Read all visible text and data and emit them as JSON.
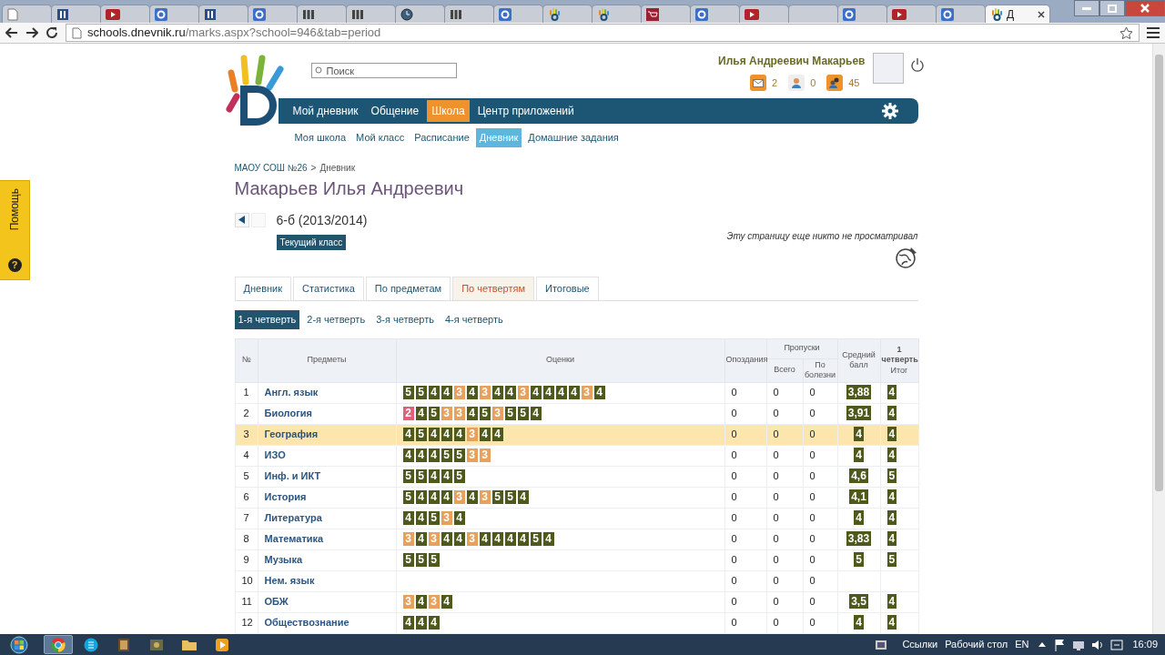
{
  "browser": {
    "tabs": [
      {
        "kind": "page",
        "selected": false
      },
      {
        "kind": "doc",
        "selected": false
      },
      {
        "kind": "video",
        "selected": false
      },
      {
        "kind": "tile",
        "selected": false
      },
      {
        "kind": "doc",
        "selected": false
      },
      {
        "kind": "tile",
        "selected": false
      },
      {
        "kind": "grid",
        "selected": false
      },
      {
        "kind": "grid",
        "selected": false
      },
      {
        "kind": "clock",
        "selected": false
      },
      {
        "kind": "grid",
        "selected": false
      },
      {
        "kind": "tile",
        "selected": false
      },
      {
        "kind": "hand",
        "selected": false
      },
      {
        "kind": "hand",
        "selected": false
      },
      {
        "kind": "shop",
        "selected": false
      },
      {
        "kind": "tile",
        "selected": false
      },
      {
        "kind": "video",
        "selected": false
      },
      {
        "kind": "blank",
        "selected": false
      },
      {
        "kind": "tile",
        "selected": false
      },
      {
        "kind": "video",
        "selected": false
      },
      {
        "kind": "tile",
        "selected": false
      },
      {
        "kind": "hand",
        "selected": true,
        "title": "Д"
      }
    ],
    "address": {
      "host": "schools.dnevnik.ru",
      "path": "/marks.aspx?school=946&tab=period"
    }
  },
  "help": {
    "icon": "?",
    "label": "Помощь"
  },
  "header": {
    "search_placeholder": "Поиск",
    "user_name": "Илья Андреевич Макарьев",
    "counters": [
      {
        "kind": "mail",
        "count": "2"
      },
      {
        "kind": "person",
        "count": "0"
      },
      {
        "kind": "group",
        "count": "45"
      }
    ]
  },
  "main_nav": [
    {
      "label": "Мой дневник",
      "selected": false
    },
    {
      "label": "Общение",
      "selected": false
    },
    {
      "label": "Школа",
      "selected": true
    },
    {
      "label": "Центр приложений",
      "selected": false
    }
  ],
  "sub_nav": [
    {
      "label": "Моя школа",
      "selected": false
    },
    {
      "label": "Мой класс",
      "selected": false
    },
    {
      "label": "Расписание",
      "selected": false
    },
    {
      "label": "Дневник",
      "selected": true
    },
    {
      "label": "Домашние задания",
      "selected": false
    }
  ],
  "breadcrumb": {
    "items": [
      "МАОУ СОШ №26",
      "Дневник"
    ],
    "separator": ">"
  },
  "page_title": "Макарьев Илья Андреевич",
  "class_info": {
    "name": "6-б (2013/2014)",
    "badge": "Текущий класс"
  },
  "view_note": "Эту страницу еще никто не просматривал",
  "tabs": [
    {
      "label": "Дневник",
      "selected": false
    },
    {
      "label": "Статистика",
      "selected": false
    },
    {
      "label": "По предметам",
      "selected": false
    },
    {
      "label": "По четвертям",
      "selected": true
    },
    {
      "label": "Итоговые",
      "selected": false
    }
  ],
  "quarters": [
    {
      "label": "1-я четверть",
      "selected": true
    },
    {
      "label": "2-я четверть",
      "selected": false
    },
    {
      "label": "3-я четверть",
      "selected": false
    },
    {
      "label": "4-я четверть",
      "selected": false
    }
  ],
  "table": {
    "columns": [
      {
        "label": "№"
      },
      {
        "label": "Предметы"
      },
      {
        "label": "Оценки"
      },
      {
        "label": "Опоздания"
      },
      {
        "label": "Пропуски",
        "children": [
          {
            "label": "Всего"
          },
          {
            "label": "По болезни"
          }
        ]
      },
      {
        "label": "Средний балл"
      },
      {
        "label": "1 четверть",
        "sublabel": "Итог"
      }
    ],
    "rows": [
      {
        "num": "1",
        "subject": "Англ. язык",
        "highlighted": false,
        "marks": [
          {
            "text": "5",
            "color": "#4e5a1c"
          },
          {
            "text": "5",
            "color": "#4e5a1c"
          },
          {
            "text": "4",
            "color": "#4e5a1c"
          },
          {
            "text": "4",
            "color": "#4e5a1c"
          },
          {
            "text": "3",
            "color": "#e8a05a"
          },
          {
            "text": "4",
            "color": "#4e5a1c"
          },
          {
            "text": "3",
            "color": "#e8a05a"
          },
          {
            "text": "4",
            "color": "#4e5a1c"
          },
          {
            "text": "4",
            "color": "#4e5a1c"
          },
          {
            "text": "3",
            "color": "#e8a05a"
          },
          {
            "text": "4",
            "color": "#4e5a1c"
          },
          {
            "text": "4",
            "color": "#4e5a1c"
          },
          {
            "text": "4",
            "color": "#4e5a1c"
          },
          {
            "text": "4",
            "color": "#4e5a1c"
          },
          {
            "text": "3",
            "color": "#e8a05a"
          },
          {
            "text": "4",
            "color": "#4e5a1c"
          }
        ],
        "late": "0",
        "absent": "0",
        "sick": "0",
        "average": "3,88",
        "final": "4"
      },
      {
        "num": "2",
        "subject": "Биология",
        "highlighted": false,
        "marks": [
          {
            "text": "2",
            "color": "#e0607a"
          },
          {
            "text": "4",
            "color": "#4e5a1c"
          },
          {
            "text": "5",
            "color": "#4e5a1c"
          },
          {
            "text": "3",
            "color": "#e8a05a"
          },
          {
            "text": "3",
            "color": "#e8a05a"
          },
          {
            "text": "4",
            "color": "#4e5a1c"
          },
          {
            "text": "5",
            "color": "#4e5a1c"
          },
          {
            "text": "3",
            "color": "#e8a05a"
          },
          {
            "text": "5",
            "color": "#4e5a1c"
          },
          {
            "text": "5",
            "color": "#4e5a1c"
          },
          {
            "text": "4",
            "color": "#4e5a1c"
          }
        ],
        "late": "0",
        "absent": "0",
        "sick": "0",
        "average": "3,91",
        "final": "4"
      },
      {
        "num": "3",
        "subject": "География",
        "highlighted": true,
        "marks": [
          {
            "text": "4",
            "color": "#4e5a1c"
          },
          {
            "text": "5",
            "color": "#4e5a1c"
          },
          {
            "text": "4",
            "color": "#4e5a1c"
          },
          {
            "text": "4",
            "color": "#4e5a1c"
          },
          {
            "text": "4",
            "color": "#4e5a1c"
          },
          {
            "text": "3",
            "color": "#e8a05a"
          },
          {
            "text": "4",
            "color": "#4e5a1c"
          },
          {
            "text": "4",
            "color": "#4e5a1c"
          }
        ],
        "late": "0",
        "absent": "0",
        "sick": "0",
        "average": "4",
        "final": "4"
      },
      {
        "num": "4",
        "subject": "ИЗО",
        "highlighted": false,
        "marks": [
          {
            "text": "4",
            "color": "#4e5a1c"
          },
          {
            "text": "4",
            "color": "#4e5a1c"
          },
          {
            "text": "4",
            "color": "#4e5a1c"
          },
          {
            "text": "5",
            "color": "#4e5a1c"
          },
          {
            "text": "5",
            "color": "#4e5a1c"
          },
          {
            "text": "3",
            "color": "#e8a05a"
          },
          {
            "text": "3",
            "color": "#e8a05a"
          }
        ],
        "late": "0",
        "absent": "0",
        "sick": "0",
        "average": "4",
        "final": "4"
      },
      {
        "num": "5",
        "subject": "Инф. и ИКТ",
        "highlighted": false,
        "marks": [
          {
            "text": "5",
            "color": "#4e5a1c"
          },
          {
            "text": "5",
            "color": "#4e5a1c"
          },
          {
            "text": "4",
            "color": "#4e5a1c"
          },
          {
            "text": "4",
            "color": "#4e5a1c"
          },
          {
            "text": "5",
            "color": "#4e5a1c"
          }
        ],
        "late": "0",
        "absent": "0",
        "sick": "0",
        "average": "4,6",
        "final": "5"
      },
      {
        "num": "6",
        "subject": "История",
        "highlighted": false,
        "marks": [
          {
            "text": "5",
            "color": "#4e5a1c"
          },
          {
            "text": "4",
            "color": "#4e5a1c"
          },
          {
            "text": "4",
            "color": "#4e5a1c"
          },
          {
            "text": "4",
            "color": "#4e5a1c"
          },
          {
            "text": "3",
            "color": "#e8a05a"
          },
          {
            "text": "4",
            "color": "#4e5a1c"
          },
          {
            "text": "3",
            "color": "#e8a05a"
          },
          {
            "text": "5",
            "color": "#4e5a1c"
          },
          {
            "text": "5",
            "color": "#4e5a1c"
          },
          {
            "text": "4",
            "color": "#4e5a1c"
          }
        ],
        "late": "0",
        "absent": "0",
        "sick": "0",
        "average": "4,1",
        "final": "4"
      },
      {
        "num": "7",
        "subject": "Литература",
        "highlighted": false,
        "marks": [
          {
            "text": "4",
            "color": "#4e5a1c"
          },
          {
            "text": "4",
            "color": "#4e5a1c"
          },
          {
            "text": "5",
            "color": "#4e5a1c"
          },
          {
            "text": "3",
            "color": "#e8a05a"
          },
          {
            "text": "4",
            "color": "#4e5a1c"
          }
        ],
        "late": "0",
        "absent": "0",
        "sick": "0",
        "average": "4",
        "final": "4"
      },
      {
        "num": "8",
        "subject": "Математика",
        "highlighted": false,
        "marks": [
          {
            "text": "3",
            "color": "#e8a05a"
          },
          {
            "text": "4",
            "color": "#4e5a1c"
          },
          {
            "text": "3",
            "color": "#e8a05a"
          },
          {
            "text": "4",
            "color": "#4e5a1c"
          },
          {
            "text": "4",
            "color": "#4e5a1c"
          },
          {
            "text": "3",
            "color": "#e8a05a"
          },
          {
            "text": "4",
            "color": "#4e5a1c"
          },
          {
            "text": "4",
            "color": "#4e5a1c"
          },
          {
            "text": "4",
            "color": "#4e5a1c"
          },
          {
            "text": "4",
            "color": "#4e5a1c"
          },
          {
            "text": "5",
            "color": "#4e5a1c"
          },
          {
            "text": "4",
            "color": "#4e5a1c"
          }
        ],
        "late": "0",
        "absent": "0",
        "sick": "0",
        "average": "3,83",
        "final": "4"
      },
      {
        "num": "9",
        "subject": "Музыка",
        "highlighted": false,
        "marks": [
          {
            "text": "5",
            "color": "#4e5a1c"
          },
          {
            "text": "5",
            "color": "#4e5a1c"
          },
          {
            "text": "5",
            "color": "#4e5a1c"
          }
        ],
        "late": "0",
        "absent": "0",
        "sick": "0",
        "average": "5",
        "final": "5"
      },
      {
        "num": "10",
        "subject": "Нем. язык",
        "highlighted": false,
        "late": "0",
        "absent": "0",
        "sick": "0"
      },
      {
        "num": "11",
        "subject": "ОБЖ",
        "highlighted": false,
        "marks": [
          {
            "text": "3",
            "color": "#e8a05a"
          },
          {
            "text": "4",
            "color": "#4e5a1c"
          },
          {
            "text": "3",
            "color": "#e8a05a"
          },
          {
            "text": "4",
            "color": "#4e5a1c"
          }
        ],
        "late": "0",
        "absent": "0",
        "sick": "0",
        "average": "3,5",
        "final": "4"
      },
      {
        "num": "12",
        "subject": "Обществознание",
        "highlighted": false,
        "marks": [
          {
            "text": "4",
            "color": "#4e5a1c"
          },
          {
            "text": "4",
            "color": "#4e5a1c"
          },
          {
            "text": "4",
            "color": "#4e5a1c"
          }
        ],
        "late": "0",
        "absent": "0",
        "sick": "0",
        "average": "4",
        "final": "4"
      }
    ]
  },
  "taskbar": {
    "apps": [
      {
        "kind": "browser",
        "selected": true
      },
      {
        "kind": "chat",
        "selected": false
      },
      {
        "kind": "book",
        "selected": false
      },
      {
        "kind": "game",
        "selected": false
      },
      {
        "kind": "folder",
        "selected": false
      },
      {
        "kind": "media",
        "selected": false
      }
    ],
    "toolbars": [
      "Ссылки",
      "Рабочий стол"
    ],
    "language": "EN",
    "time": "16:09"
  }
}
